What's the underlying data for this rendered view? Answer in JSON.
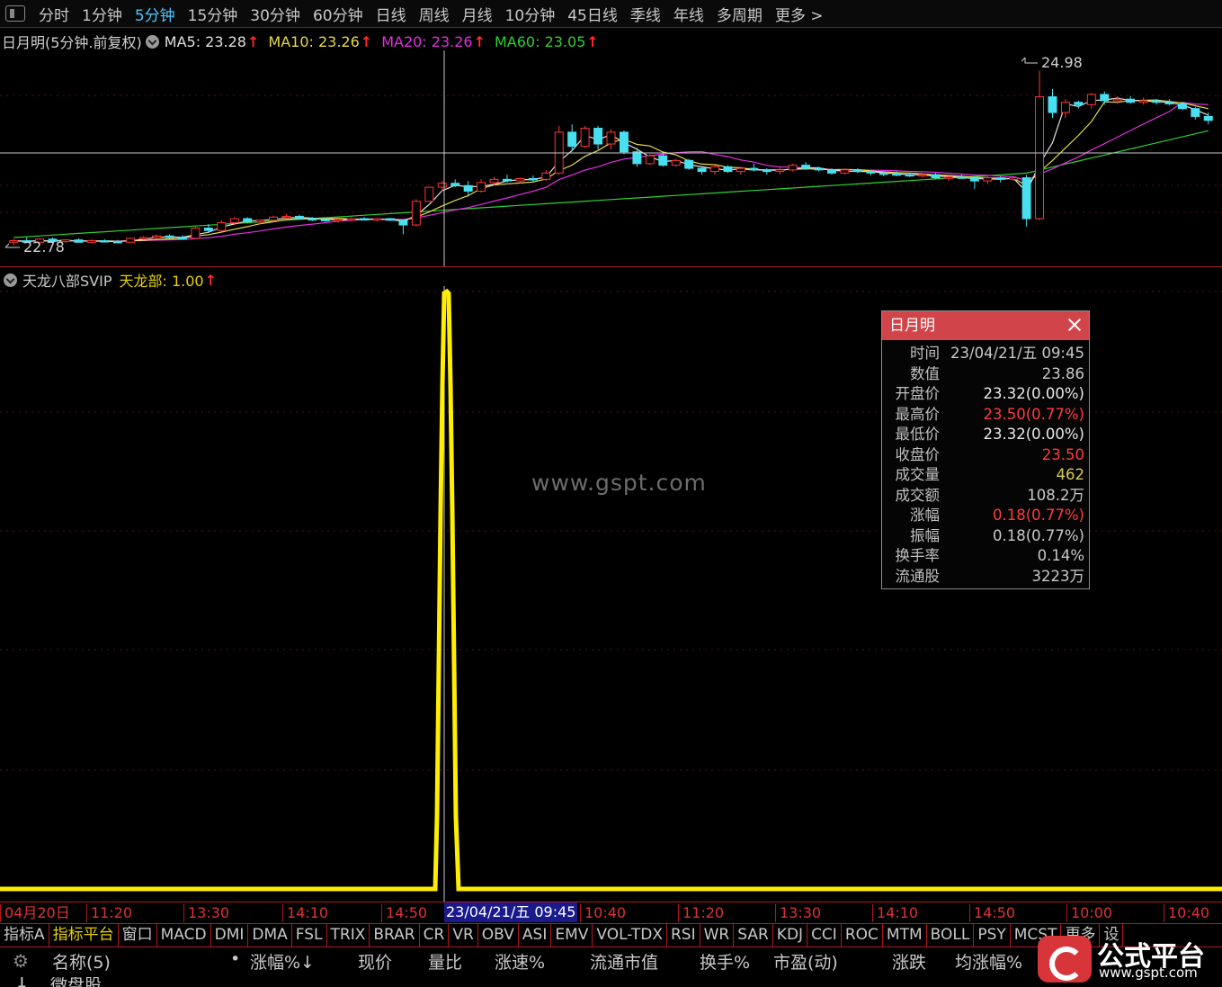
{
  "periods": [
    "分时",
    "1分钟",
    "5分钟",
    "15分钟",
    "30分钟",
    "60分钟",
    "日线",
    "周线",
    "月线",
    "10分钟",
    "45日线",
    "季线",
    "年线",
    "多周期",
    "更多 >"
  ],
  "active_period": "5分钟",
  "main": {
    "title": "日月明(5分钟.前复权)",
    "ma": [
      {
        "label": "MA5: 23.28",
        "color": "#e0e0e0"
      },
      {
        "label": "MA10: 23.26",
        "color": "#e8d84a"
      },
      {
        "label": "MA20: 23.26",
        "color": "#e030e0"
      },
      {
        "label": "MA60: 23.05",
        "color": "#30d030"
      }
    ],
    "high_label": "24.98",
    "low_label": "22.78"
  },
  "indicator": {
    "name": "天龙八部SVIP",
    "value_label": "天龙部: 1.00"
  },
  "popup": {
    "title": "日月明",
    "rows": [
      {
        "label": "时间",
        "value": "23/04/21/五 09:45",
        "color": "#c8c8c8"
      },
      {
        "label": "数值",
        "value": "23.86",
        "color": "#c8c8c8"
      },
      {
        "label": "开盘价",
        "value": "23.32(0.00%)",
        "color": "#e8e8e8"
      },
      {
        "label": "最高价",
        "value": "23.50(0.77%)",
        "color": "#ff3b3b"
      },
      {
        "label": "最低价",
        "value": "23.32(0.00%)",
        "color": "#e8e8e8"
      },
      {
        "label": "收盘价",
        "value": "23.50",
        "color": "#ff3b3b"
      },
      {
        "label": "成交量",
        "value": "462",
        "color": "#d8c85a"
      },
      {
        "label": "成交额",
        "value": "108.2万",
        "color": "#c8c8c8"
      },
      {
        "label": "涨幅",
        "value": "0.18(0.77%)",
        "color": "#ff3b3b"
      },
      {
        "label": "振幅",
        "value": "0.18(0.77%)",
        "color": "#c8c8c8"
      },
      {
        "label": "换手率",
        "value": "0.14%",
        "color": "#c8c8c8"
      },
      {
        "label": "流通股",
        "value": "3223万",
        "color": "#c8c8c8"
      }
    ]
  },
  "watermark": "www.gspt.com",
  "time_axis": {
    "labels": [
      "04月20日",
      "11:20",
      "13:30",
      "14:10",
      "14:50",
      "10:40",
      "11:20",
      "13:30",
      "14:10",
      "14:50",
      "10:00",
      "10:40"
    ],
    "cursor": "23/04/21/五 09:45"
  },
  "indicator_tabs": [
    "指标A",
    "指标平台",
    "窗口",
    "MACD",
    "DMI",
    "DMA",
    "FSL",
    "TRIX",
    "BRAR",
    "CR",
    "VR",
    "OBV",
    "ASI",
    "EMV",
    "VOL-TDX",
    "RSI",
    "WR",
    "SAR",
    "KDJ",
    "CCI",
    "ROC",
    "MTM",
    "BOLL",
    "PSY",
    "MCST",
    "更多",
    "设"
  ],
  "active_tab": "指标平台",
  "table_header": [
    "名称(5)",
    "涨幅%↓",
    "现价",
    "量比",
    "涨速%",
    "流通市值",
    "换手%",
    "市盈(动)",
    "涨跌",
    "均涨幅%"
  ],
  "row_partial": {
    "index": "1",
    "name": "微盘股"
  },
  "brand": {
    "name": "公式平台",
    "url": "www.gspt.com"
  },
  "chart_data": {
    "type": "candlestick",
    "candles": [
      [
        22.8,
        22.84,
        22.76,
        22.82
      ],
      [
        22.82,
        22.86,
        22.79,
        22.8
      ],
      [
        22.8,
        22.85,
        22.78,
        22.84
      ],
      [
        22.84,
        22.86,
        22.8,
        22.81
      ],
      [
        22.81,
        22.84,
        22.79,
        22.83
      ],
      [
        22.83,
        22.85,
        22.8,
        22.8
      ],
      [
        22.8,
        22.84,
        22.79,
        22.82
      ],
      [
        22.82,
        22.84,
        22.8,
        22.81
      ],
      [
        22.81,
        22.83,
        22.79,
        22.8
      ],
      [
        22.8,
        22.86,
        22.8,
        22.85
      ],
      [
        22.85,
        22.88,
        22.83,
        22.86
      ],
      [
        22.86,
        22.9,
        22.84,
        22.88
      ],
      [
        22.88,
        22.9,
        22.85,
        22.86
      ],
      [
        22.86,
        22.89,
        22.84,
        22.85
      ],
      [
        22.85,
        23.0,
        22.85,
        22.98
      ],
      [
        22.98,
        23.03,
        22.93,
        22.95
      ],
      [
        22.95,
        23.08,
        22.94,
        23.05
      ],
      [
        23.05,
        23.12,
        23.02,
        23.1
      ],
      [
        23.1,
        23.12,
        23.04,
        23.06
      ],
      [
        23.06,
        23.09,
        23.03,
        23.08
      ],
      [
        23.08,
        23.14,
        23.06,
        23.12
      ],
      [
        23.12,
        23.16,
        23.1,
        23.13
      ],
      [
        23.13,
        23.15,
        23.09,
        23.1
      ],
      [
        23.1,
        23.12,
        23.07,
        23.09
      ],
      [
        23.09,
        23.11,
        23.06,
        23.08
      ],
      [
        23.08,
        23.1,
        23.05,
        23.09
      ],
      [
        23.09,
        23.12,
        23.07,
        23.1
      ],
      [
        23.1,
        23.12,
        23.08,
        23.09
      ],
      [
        23.09,
        23.11,
        23.06,
        23.1
      ],
      [
        23.1,
        23.11,
        23.07,
        23.08
      ],
      [
        23.08,
        23.09,
        22.9,
        23.02
      ],
      [
        23.02,
        23.35,
        23.0,
        23.32
      ],
      [
        23.32,
        23.5,
        23.32,
        23.5
      ],
      [
        23.5,
        23.58,
        23.45,
        23.55
      ],
      [
        23.55,
        23.6,
        23.5,
        23.52
      ],
      [
        23.52,
        23.58,
        23.38,
        23.45
      ],
      [
        23.45,
        23.6,
        23.43,
        23.56
      ],
      [
        23.56,
        23.63,
        23.52,
        23.6
      ],
      [
        23.6,
        23.66,
        23.56,
        23.58
      ],
      [
        23.58,
        23.62,
        23.55,
        23.61
      ],
      [
        23.61,
        23.65,
        23.57,
        23.6
      ],
      [
        23.6,
        23.72,
        23.58,
        23.68
      ],
      [
        23.68,
        24.28,
        23.66,
        24.2
      ],
      [
        24.2,
        24.3,
        23.96,
        24.02
      ],
      [
        24.02,
        24.28,
        24.0,
        24.25
      ],
      [
        24.25,
        24.28,
        23.98,
        24.05
      ],
      [
        24.05,
        24.24,
        23.98,
        24.2
      ],
      [
        24.2,
        24.22,
        23.92,
        23.95
      ],
      [
        23.95,
        24.0,
        23.76,
        23.8
      ],
      [
        23.8,
        23.92,
        23.78,
        23.9
      ],
      [
        23.9,
        23.93,
        23.76,
        23.78
      ],
      [
        23.78,
        23.86,
        23.76,
        23.84
      ],
      [
        23.84,
        23.86,
        23.72,
        23.74
      ],
      [
        23.74,
        23.76,
        23.66,
        23.7
      ],
      [
        23.7,
        23.78,
        23.66,
        23.76
      ],
      [
        23.76,
        23.78,
        23.68,
        23.7
      ],
      [
        23.7,
        23.76,
        23.66,
        23.74
      ],
      [
        23.74,
        23.8,
        23.7,
        23.72
      ],
      [
        23.72,
        23.74,
        23.66,
        23.7
      ],
      [
        23.7,
        23.76,
        23.66,
        23.72
      ],
      [
        23.72,
        23.8,
        23.7,
        23.78
      ],
      [
        23.78,
        23.82,
        23.72,
        23.74
      ],
      [
        23.74,
        23.76,
        23.7,
        23.72
      ],
      [
        23.72,
        23.74,
        23.66,
        23.68
      ],
      [
        23.68,
        23.74,
        23.66,
        23.72
      ],
      [
        23.72,
        23.74,
        23.68,
        23.7
      ],
      [
        23.7,
        23.72,
        23.65,
        23.68
      ],
      [
        23.68,
        23.7,
        23.64,
        23.67
      ],
      [
        23.67,
        23.7,
        23.64,
        23.66
      ],
      [
        23.66,
        23.68,
        23.63,
        23.65
      ],
      [
        23.65,
        23.68,
        23.62,
        23.66
      ],
      [
        23.66,
        23.68,
        23.6,
        23.62
      ],
      [
        23.62,
        23.65,
        23.58,
        23.63
      ],
      [
        23.63,
        23.66,
        23.6,
        23.62
      ],
      [
        23.62,
        23.64,
        23.48,
        23.58
      ],
      [
        23.58,
        23.64,
        23.54,
        23.62
      ],
      [
        23.62,
        23.64,
        23.56,
        23.6
      ],
      [
        23.6,
        23.63,
        23.58,
        23.62
      ],
      [
        23.62,
        23.66,
        23.0,
        23.1
      ],
      [
        23.1,
        24.98,
        23.08,
        24.65
      ],
      [
        24.65,
        24.75,
        24.38,
        24.45
      ],
      [
        24.45,
        24.62,
        24.38,
        24.58
      ],
      [
        24.58,
        24.6,
        24.5,
        24.55
      ],
      [
        24.55,
        24.7,
        24.5,
        24.68
      ],
      [
        24.68,
        24.72,
        24.55,
        24.6
      ],
      [
        24.6,
        24.66,
        24.56,
        24.62
      ],
      [
        24.62,
        24.66,
        24.56,
        24.58
      ],
      [
        24.58,
        24.64,
        24.55,
        24.6
      ],
      [
        24.6,
        24.62,
        24.55,
        24.58
      ],
      [
        24.58,
        24.62,
        24.54,
        24.56
      ],
      [
        24.56,
        24.58,
        24.48,
        24.5
      ],
      [
        24.5,
        24.52,
        24.36,
        24.4
      ],
      [
        24.4,
        24.45,
        24.3,
        24.35
      ]
    ],
    "cursor_index": 32,
    "indicator_values": {
      "spike_index": 32,
      "spike_value": 1.0,
      "baseline": 0.0
    },
    "y_range": [
      22.78,
      24.98
    ]
  }
}
